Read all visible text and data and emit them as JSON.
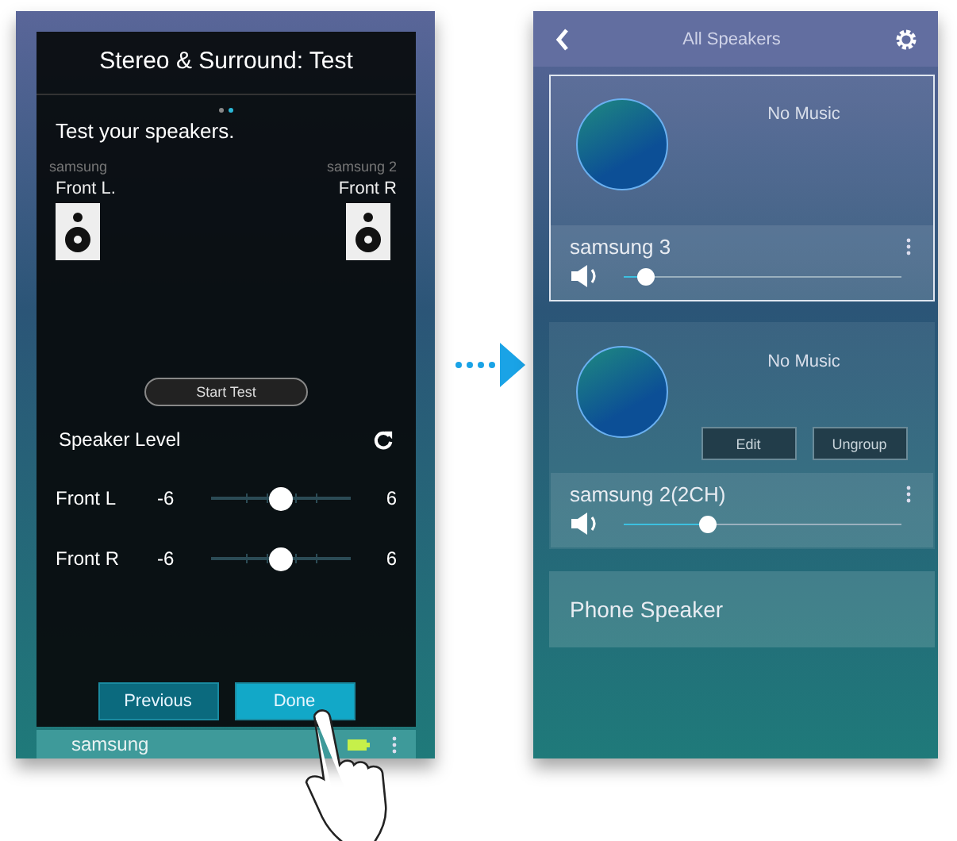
{
  "left_screen": {
    "dialog": {
      "title": "Stereo & Surround: Test",
      "pager": [
        {
          "selected": false
        },
        {
          "selected": true
        }
      ],
      "instruction": "Test your speakers.",
      "speakers": [
        {
          "device": "samsung",
          "channel": "Front L."
        },
        {
          "device": "samsung 2",
          "channel": "Front R"
        }
      ],
      "start_button": "Start Test",
      "level_heading": "Speaker Level",
      "levels": [
        {
          "label": "Front L",
          "min": "-6",
          "max": "6",
          "level": 0.5
        },
        {
          "label": "Front R",
          "min": "-6",
          "max": "6",
          "level": 0.5
        }
      ],
      "buttons": [
        {
          "label": "Previous",
          "selected": false
        },
        {
          "label": "Done",
          "selected": true
        }
      ]
    },
    "bottom_row": {
      "name": "samsung"
    }
  },
  "right_screen": {
    "header": {
      "title": "All Speakers"
    },
    "cards": [
      {
        "kind": "group",
        "status": "No Music",
        "selected": true,
        "speaker": "samsung 3",
        "level": 0.08
      },
      {
        "kind": "group",
        "status": "No Music",
        "selected": false,
        "buttons": [
          "Edit",
          "Ungroup"
        ],
        "speaker": "samsung 2(2CH)",
        "level": 0.3
      },
      {
        "kind": "phone",
        "speaker": "Phone Speaker",
        "selected": false
      }
    ]
  }
}
